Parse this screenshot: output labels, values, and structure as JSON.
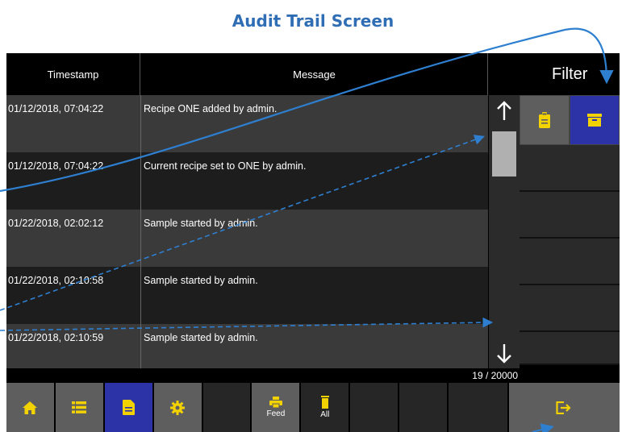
{
  "page_title": "Audit Trail Screen",
  "table": {
    "col_timestamp": "Timestamp",
    "col_message": "Message",
    "rows": [
      {
        "timestamp": "01/12/2018, 07:04:22",
        "message": "Recipe ONE added by admin."
      },
      {
        "timestamp": "01/12/2018, 07:04:22",
        "message": "Current recipe set to ONE by admin."
      },
      {
        "timestamp": "01/22/2018, 02:02:12",
        "message": "Sample started by admin."
      },
      {
        "timestamp": "01/22/2018, 02:10:58",
        "message": "Sample started by admin."
      },
      {
        "timestamp": "01/22/2018, 02:10:59",
        "message": "Sample started by admin."
      }
    ],
    "counter": "19 / 20000"
  },
  "scrollbar": {
    "up_icon": "arrow-up-icon",
    "down_icon": "arrow-down-icon"
  },
  "filter": {
    "label": "Filter",
    "buttons": [
      {
        "icon": "clipboard-icon",
        "active": false
      },
      {
        "icon": "archive-box-icon",
        "active": true
      }
    ]
  },
  "nav": {
    "buttons": [
      {
        "icon": "home-icon",
        "label": ""
      },
      {
        "icon": "list-icon",
        "label": ""
      },
      {
        "icon": "document-icon",
        "label": "",
        "active": true
      },
      {
        "icon": "gear-icon",
        "label": ""
      },
      {
        "icon": "",
        "label": ""
      },
      {
        "icon": "printer-icon",
        "label": "Feed"
      },
      {
        "icon": "trash-icon",
        "label": "All"
      },
      {
        "icon": "",
        "label": ""
      },
      {
        "icon": "",
        "label": ""
      },
      {
        "icon": "",
        "label": ""
      },
      {
        "icon": "logout-icon",
        "label": ""
      }
    ]
  },
  "colors": {
    "title": "#2f6eb5",
    "active_button": "#2b33a6",
    "icon_yellow": "#f2d200",
    "annotation": "#2e7fd0"
  }
}
